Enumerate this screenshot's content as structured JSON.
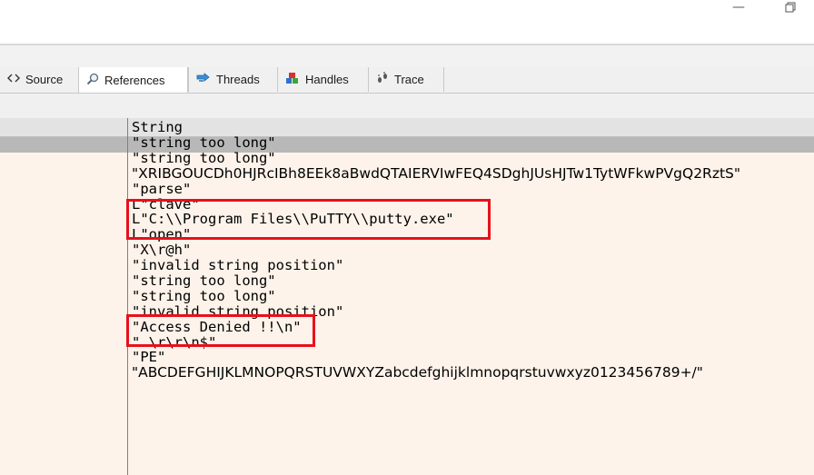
{
  "tabs": [
    {
      "label": "Source",
      "icon": "code-brackets-icon"
    },
    {
      "label": "References",
      "icon": "search-icon",
      "active": true
    },
    {
      "label": "Threads",
      "icon": "threads-icon"
    },
    {
      "label": "Handles",
      "icon": "handles-icon"
    },
    {
      "label": "Trace",
      "icon": "footprints-icon"
    }
  ],
  "grid": {
    "column_header": "String",
    "rows": [
      "\"string too long\"",
      "\"string too long\"",
      "\"XRIBGOUCDh0HJRcIBh8EEk8aBwdQTAIERVIwFEQ4SDghJUsHJTw1TytWFkwPVgQ2RztS\"",
      "\"parse\"",
      "L\"clave\"",
      "L\"C:\\\\Program Files\\\\PuTTY\\\\putty.exe\"",
      "L\"open\"",
      "\"X\\r@h\"",
      "\"invalid string position\"",
      "\"string too long\"",
      "\"string too long\"",
      "\"invalid string position\"",
      "\"Access Denied !!\\n\"",
      "\".\\r\\r\\n$\"",
      "\"PE\"",
      "\"ABCDEFGHIJKLMNOPQRSTUVWXYZabcdefghijklmnopqrstuvwxyz0123456789+/\""
    ]
  },
  "highlight_color": "#e8101c",
  "grid_background": "#fdf3ea"
}
